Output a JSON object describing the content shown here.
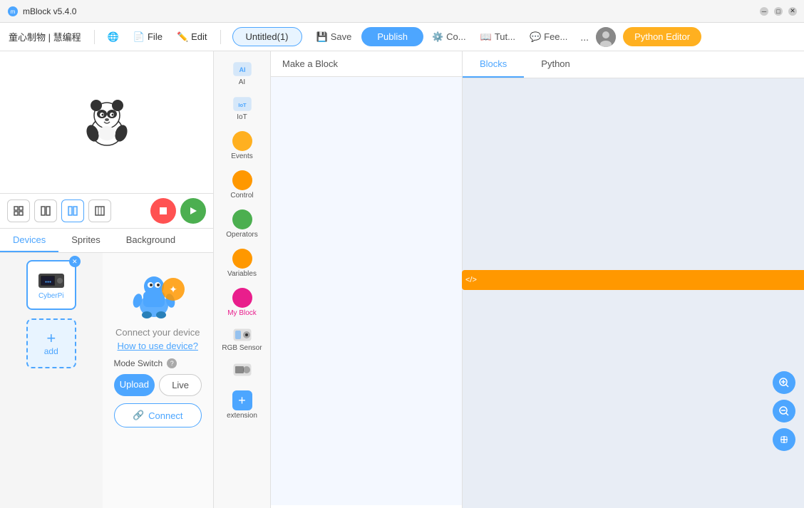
{
  "titleBar": {
    "appName": "mBlock v5.4.0"
  },
  "menuBar": {
    "logo": "童心制物 | 慧编程",
    "globeIcon": "🌐",
    "fileLabel": "File",
    "editLabel": "Edit",
    "projectName": "Untitled(1)",
    "saveLabel": "Save",
    "publishLabel": "Publish",
    "connectLabel": "Co...",
    "tutorialLabel": "Tut...",
    "feedbackLabel": "Fee...",
    "moreLabel": "...",
    "pythonEditorLabel": "Python Editor"
  },
  "stageControls": {
    "stopIcon": "■",
    "goIcon": "▶"
  },
  "tabs": {
    "devices": "Devices",
    "sprites": "Sprites",
    "background": "Background"
  },
  "devicePanel": {
    "deviceName": "CyberPi",
    "addLabel": "add",
    "connectText": "Connect your device",
    "howToLink": "How to use device?",
    "modeSwitchLabel": "Mode Switch",
    "uploadLabel": "Upload",
    "liveLabel": "Live",
    "connectLabel": "Connect",
    "linkIcon": "🔗"
  },
  "blockCategories": [
    {
      "id": "ai",
      "label": "AI",
      "type": "icon",
      "color": "#4da6ff"
    },
    {
      "id": "iot",
      "label": "IoT",
      "type": "icon",
      "color": "#4da6ff"
    },
    {
      "id": "events",
      "label": "Events",
      "type": "dot",
      "color": "#ffb020"
    },
    {
      "id": "control",
      "label": "Control",
      "type": "dot",
      "color": "#ff9800"
    },
    {
      "id": "operators",
      "label": "Operators",
      "type": "dot",
      "color": "#4CAF50"
    },
    {
      "id": "variables",
      "label": "Variables",
      "type": "dot",
      "color": "#ff9800"
    },
    {
      "id": "myblock",
      "label": "My Block",
      "type": "dot",
      "color": "#e91e8c"
    },
    {
      "id": "rgb-sensor",
      "label": "RGB Sensor",
      "type": "icon",
      "color": "#4da6ff"
    },
    {
      "id": "cyberpi-icon",
      "label": "",
      "type": "icon",
      "color": "#4da6ff"
    },
    {
      "id": "extension",
      "label": "extension",
      "type": "plus",
      "color": "#4da6ff"
    }
  ],
  "blockArea": {
    "makeBlockLabel": "Make a Block",
    "tabs": {
      "blocksLabel": "Blocks",
      "pythonLabel": "Python"
    }
  },
  "codeTools": {
    "zoomInIcon": "+",
    "zoomOutIcon": "-",
    "centerIcon": "="
  },
  "xmlBadge": "</>",
  "colors": {
    "primary": "#4da6ff",
    "accent": "#ffb020",
    "danger": "#ff5252",
    "success": "#4CAF50",
    "myblock": "#e91e8c"
  }
}
